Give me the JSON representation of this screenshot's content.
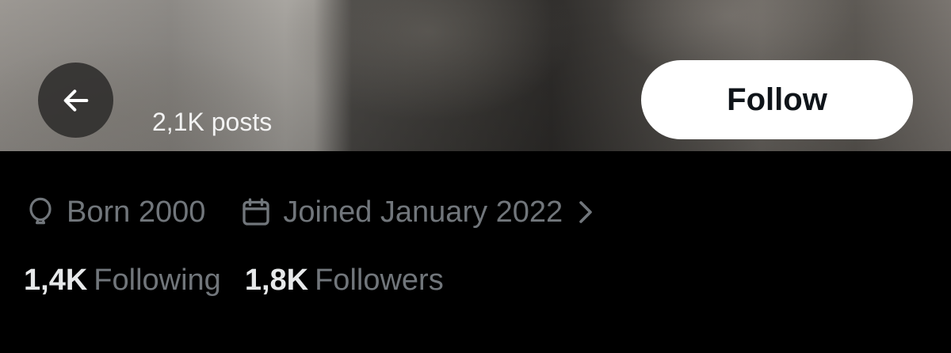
{
  "header": {
    "back_icon": "arrow-left-icon",
    "post_count": "2,1K posts",
    "follow_label": "Follow"
  },
  "profile_meta": {
    "birth_icon": "balloon-icon",
    "birth": "Born 2000",
    "joined_icon": "calendar-icon",
    "joined": "Joined January 2022",
    "joined_chevron_icon": "chevron-right-icon"
  },
  "stats": {
    "following_count": "1,4K",
    "following_label": "Following",
    "followers_count": "1,8K",
    "followers_label": "Followers"
  },
  "colors": {
    "background": "#000000",
    "primary_text": "#e7e9ea",
    "secondary_text": "#71767b",
    "follow_button_bg": "#ffffff",
    "follow_button_text": "#0f1419"
  }
}
